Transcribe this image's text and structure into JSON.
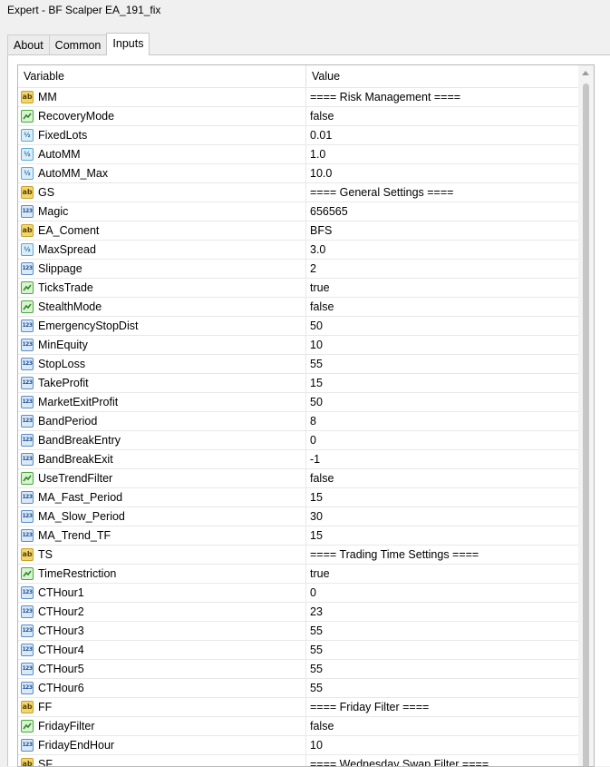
{
  "window": {
    "title": "Expert - BF Scalper EA_191_fix"
  },
  "tabs": [
    {
      "label": "About",
      "active": false
    },
    {
      "label": "Common",
      "active": false
    },
    {
      "label": "Inputs",
      "active": true
    }
  ],
  "grid": {
    "columns": {
      "variable": "Variable",
      "value": "Value"
    },
    "rows": [
      {
        "type": "string",
        "icon": "string-icon",
        "name": "MM",
        "value": "==== Risk Management ===="
      },
      {
        "type": "bool",
        "icon": "bool-icon",
        "name": "RecoveryMode",
        "value": "false"
      },
      {
        "type": "double",
        "icon": "double-icon",
        "name": "FixedLots",
        "value": "0.01"
      },
      {
        "type": "double",
        "icon": "double-icon",
        "name": "AutoMM",
        "value": "1.0"
      },
      {
        "type": "double",
        "icon": "double-icon",
        "name": "AutoMM_Max",
        "value": "10.0"
      },
      {
        "type": "string",
        "icon": "string-icon",
        "name": "GS",
        "value": "==== General Settings ===="
      },
      {
        "type": "int",
        "icon": "int-icon",
        "name": "Magic",
        "value": "656565"
      },
      {
        "type": "string",
        "icon": "string-icon",
        "name": "EA_Coment",
        "value": "BFS"
      },
      {
        "type": "double",
        "icon": "double-icon",
        "name": "MaxSpread",
        "value": "3.0"
      },
      {
        "type": "int",
        "icon": "int-icon",
        "name": "Slippage",
        "value": "2"
      },
      {
        "type": "bool",
        "icon": "bool-icon",
        "name": "TicksTrade",
        "value": "true"
      },
      {
        "type": "bool",
        "icon": "bool-icon",
        "name": "StealthMode",
        "value": "false"
      },
      {
        "type": "int",
        "icon": "int-icon",
        "name": "EmergencyStopDist",
        "value": "50"
      },
      {
        "type": "int",
        "icon": "int-icon",
        "name": "MinEquity",
        "value": "10"
      },
      {
        "type": "int",
        "icon": "int-icon",
        "name": "StopLoss",
        "value": "55"
      },
      {
        "type": "int",
        "icon": "int-icon",
        "name": "TakeProfit",
        "value": "15"
      },
      {
        "type": "int",
        "icon": "int-icon",
        "name": "MarketExitProfit",
        "value": "50"
      },
      {
        "type": "int",
        "icon": "int-icon",
        "name": "BandPeriod",
        "value": "8"
      },
      {
        "type": "int",
        "icon": "int-icon",
        "name": "BandBreakEntry",
        "value": "0"
      },
      {
        "type": "int",
        "icon": "int-icon",
        "name": "BandBreakExit",
        "value": "-1"
      },
      {
        "type": "bool",
        "icon": "bool-icon",
        "name": "UseTrendFilter",
        "value": "false"
      },
      {
        "type": "int",
        "icon": "int-icon",
        "name": "MA_Fast_Period",
        "value": "15"
      },
      {
        "type": "int",
        "icon": "int-icon",
        "name": "MA_Slow_Period",
        "value": "30"
      },
      {
        "type": "int",
        "icon": "int-icon",
        "name": "MA_Trend_TF",
        "value": "15"
      },
      {
        "type": "string",
        "icon": "string-icon",
        "name": "TS",
        "value": "==== Trading Time Settings ===="
      },
      {
        "type": "bool",
        "icon": "bool-icon",
        "name": "TimeRestriction",
        "value": "true"
      },
      {
        "type": "int",
        "icon": "int-icon",
        "name": "CTHour1",
        "value": "0"
      },
      {
        "type": "int",
        "icon": "int-icon",
        "name": "CTHour2",
        "value": "23"
      },
      {
        "type": "int",
        "icon": "int-icon",
        "name": "CTHour3",
        "value": "55"
      },
      {
        "type": "int",
        "icon": "int-icon",
        "name": "CTHour4",
        "value": "55"
      },
      {
        "type": "int",
        "icon": "int-icon",
        "name": "CTHour5",
        "value": "55"
      },
      {
        "type": "int",
        "icon": "int-icon",
        "name": "CTHour6",
        "value": "55"
      },
      {
        "type": "string",
        "icon": "string-icon",
        "name": "FF",
        "value": "==== Friday Filter ===="
      },
      {
        "type": "bool",
        "icon": "bool-icon",
        "name": "FridayFilter",
        "value": "false"
      },
      {
        "type": "int",
        "icon": "int-icon",
        "name": "FridayEndHour",
        "value": "10"
      },
      {
        "type": "string",
        "icon": "string-icon",
        "name": "SF",
        "value": "==== Wednesday Swap Filter ===="
      }
    ]
  }
}
